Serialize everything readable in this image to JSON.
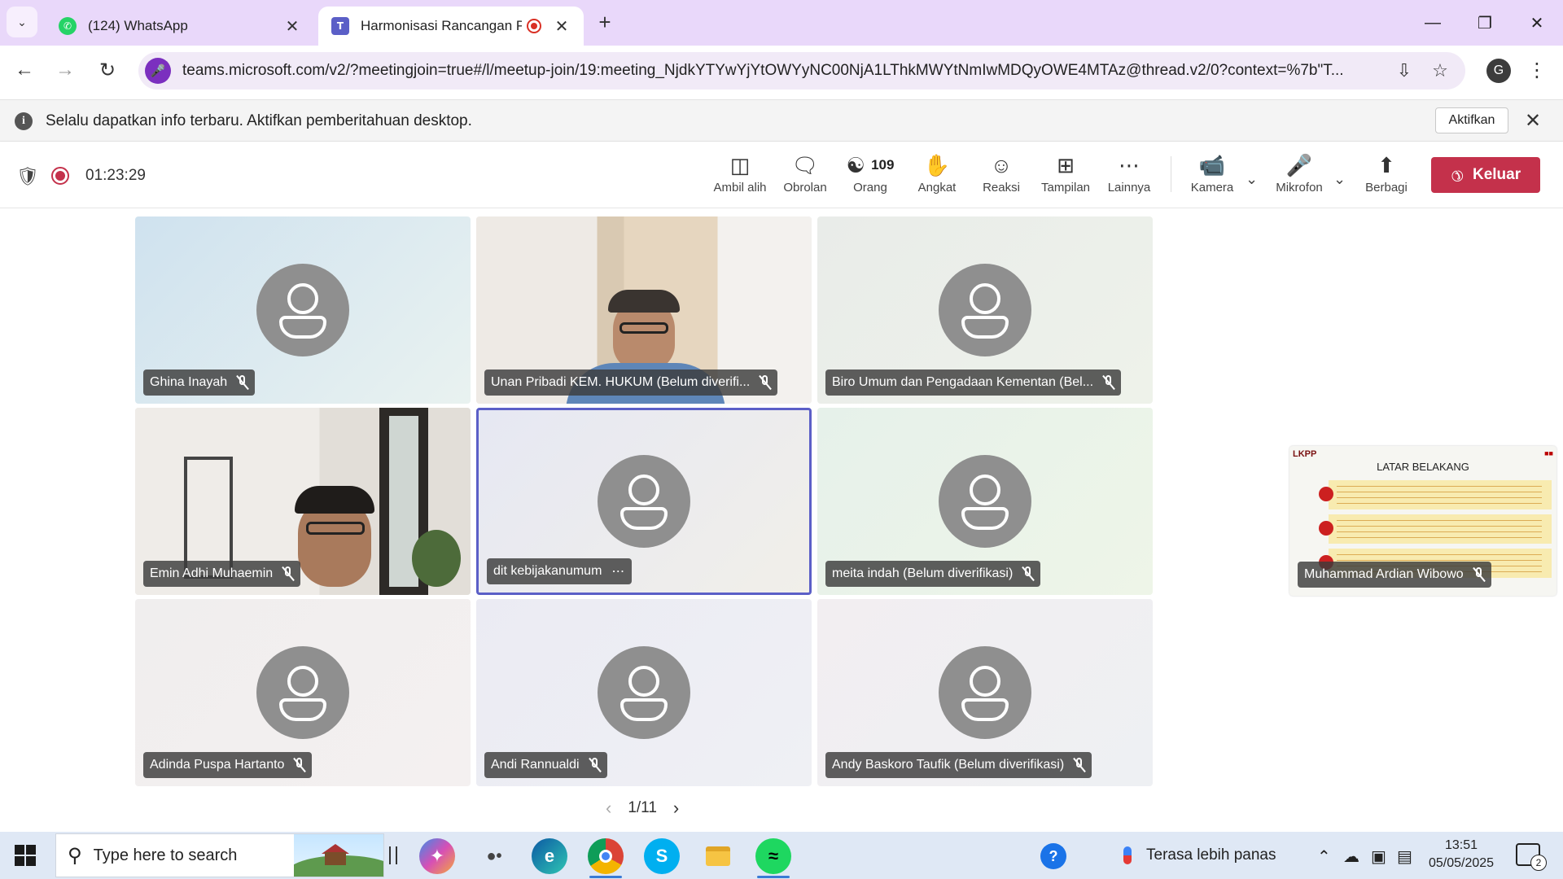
{
  "browser": {
    "tabs": [
      {
        "title": "(124) WhatsApp",
        "icon": "whatsapp-icon",
        "active": false
      },
      {
        "title": "Harmonisasi Rancangan Per",
        "icon": "teams-icon",
        "active": true,
        "recording": true
      }
    ],
    "url": "teams.microsoft.com/v2/?meetingjoin=true#/l/meetup-join/19:meeting_NjdkYTYwYjYtOWYyNC00NjA1LThkMWYtNmIwMDQyOWE4MTAz@thread.v2/0?context=%7b\"T...",
    "profile_initial": "G"
  },
  "notification": {
    "text": "Selalu dapatkan info terbaru. Aktifkan pemberitahuan desktop.",
    "button": "Aktifkan"
  },
  "meeting": {
    "timer": "01:23:29",
    "participant_count": "109",
    "controls": {
      "takeover": "Ambil alih",
      "chat": "Obrolan",
      "people": "Orang",
      "raise": "Angkat",
      "react": "Reaksi",
      "view": "Tampilan",
      "more": "Lainnya",
      "camera": "Kamera",
      "mic": "Mikrofon",
      "share": "Berbagi",
      "leave": "Keluar"
    },
    "colors": {
      "accent": "#5b5fc7",
      "leave": "#c4314b"
    },
    "tiles": [
      {
        "name": "Ghina Inayah",
        "muted": true
      },
      {
        "name": "Unan Pribadi KEM. HUKUM (Belum diverifi...",
        "muted": true
      },
      {
        "name": "Biro Umum dan Pengadaan Kementan (Bel...",
        "muted": true
      },
      {
        "name": "Emin Adhi Muhaemin",
        "muted": true
      },
      {
        "name": "dit kebijakanumum",
        "muted": false,
        "selected": true
      },
      {
        "name": "meita indah (Belum diverifikasi)",
        "muted": true
      },
      {
        "name": "Adinda Puspa Hartanto",
        "muted": true
      },
      {
        "name": "Andi Rannualdi",
        "muted": true
      },
      {
        "name": "Andy Baskoro Taufik (Belum diverifikasi)",
        "muted": true
      }
    ],
    "pagination": "1/11",
    "share": {
      "logo": "LKPP",
      "slide_title": "LATAR BELAKANG",
      "presenter": "Muhammad Ardian Wibowo",
      "muted": true
    }
  },
  "taskbar": {
    "search_placeholder": "Type here to search",
    "weather": "Terasa lebih panas",
    "time": "13:51",
    "date": "05/05/2025",
    "notification_count": "2"
  }
}
